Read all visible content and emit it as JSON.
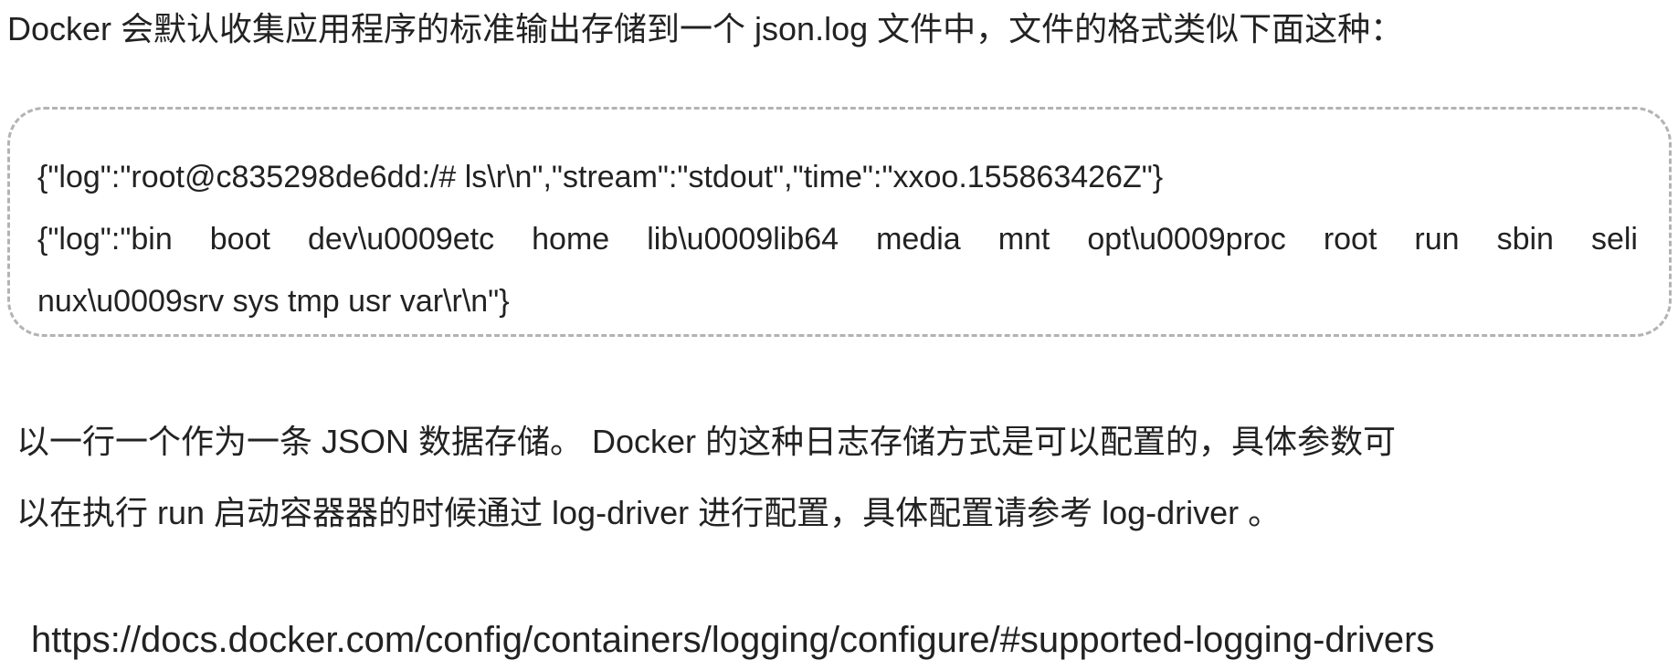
{
  "intro": {
    "text": "Docker 会默认收集应用程序的标准输出存储到一个  json.log 文件中，文件的格式类似下面这种："
  },
  "code_block": {
    "lines": [
      "{\"log\":\"root@c835298de6dd:/# ls\\r\\n\",\"stream\":\"stdout\",\"time\":\"xxoo.155863426Z\"}",
      "{\"log\":\"bin boot dev\\u0009etc home lib\\u0009lib64 media mnt opt\\u0009proc root run sbin seli",
      "nux\\u0009srv sys tmp usr var\\r\\n\"}"
    ]
  },
  "paragraph": {
    "lines": [
      "以一行一个作为一条 JSON 数据存储。 Docker 的这种日志存储方式是可以配置的，具体参数可",
      "以在执行 run 启动容器器的时候通过 log-driver 进行配置，具体配置请参考 log-driver 。"
    ]
  },
  "link": {
    "url": "https://docs.docker.com/config/containers/logging/configure/#supported-logging-drivers"
  }
}
